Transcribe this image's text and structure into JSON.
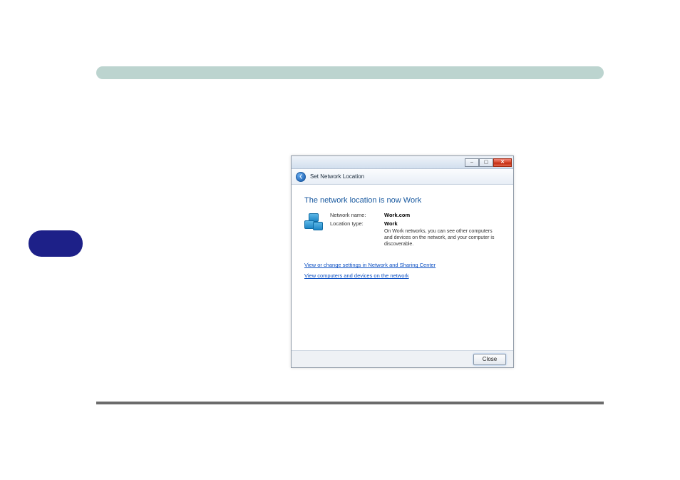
{
  "dialog": {
    "subheader": {
      "title": "Set Network Location",
      "faded1": "",
      "faded2": ""
    },
    "heading": "The network location is now Work",
    "fields": {
      "name_label": "Network name:",
      "name_value": "Work.com",
      "type_label": "Location type:",
      "type_value": "Work",
      "description": "On Work networks, you can see other computers and devices on the network, and your computer is discoverable."
    },
    "links": {
      "settings": "View or change settings in Network and Sharing Center",
      "devices": "View computers and devices on the network"
    },
    "close_label": "Close",
    "win_controls": {
      "min": "–",
      "max": "▢",
      "close": "✕"
    }
  }
}
